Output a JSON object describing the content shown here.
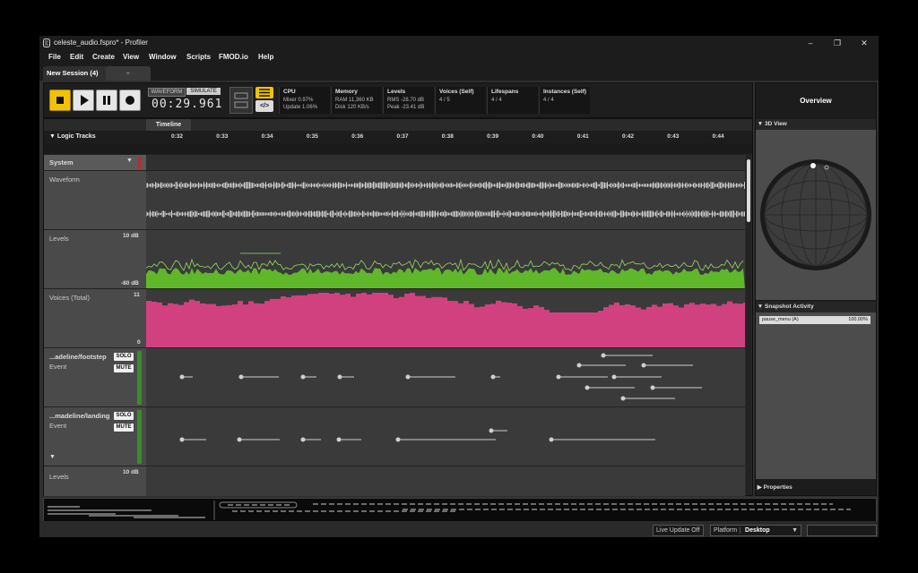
{
  "window": {
    "title": "celeste_audio.fspro* - Profiler"
  },
  "menu": [
    "File",
    "Edit",
    "Create",
    "View",
    "Window",
    "Scripts",
    "FMOD.io",
    "Help"
  ],
  "tabs": {
    "active": "New Session (4)",
    "add": "+"
  },
  "transport": {
    "mode_waveform": "WAVEFORM",
    "mode_simulate": "SIMULATE",
    "time": "00:29.961",
    "code_label": "</>"
  },
  "meters": [
    {
      "title": "CPU",
      "line1": "Mixer 0.97%",
      "line2": "Update 1.06%"
    },
    {
      "title": "Memory",
      "line1": "RAM 11,360 KB",
      "line2": "Disk 120 KB/s"
    },
    {
      "title": "Levels",
      "line1": "RMS -28.70 dB",
      "line2": "Peak -23.41 dB"
    },
    {
      "title": "Voices (Self)",
      "line1": "4 / 5",
      "line2": ""
    },
    {
      "title": "Lifespans",
      "line1": "4 / 4",
      "line2": ""
    },
    {
      "title": "Instances (Self)",
      "line1": "4 / 4",
      "line2": ""
    }
  ],
  "timeline": {
    "header": "Timeline",
    "logic_tracks": "Logic Tracks",
    "ticks": [
      "0:32",
      "0:33",
      "0:34",
      "0:35",
      "0:36",
      "0:37",
      "0:38",
      "0:39",
      "0:40",
      "0:41",
      "0:42",
      "0:43",
      "0:44"
    ]
  },
  "tracks": {
    "system": "System",
    "waveform": "Waveform",
    "levels": {
      "label": "Levels",
      "top": "10 dB",
      "bottom": "-80 dB"
    },
    "voices": {
      "label": "Voices (Total)",
      "top": "11",
      "bottom": "0"
    },
    "footstep": {
      "name": "...adeline/footstep",
      "type": "Event",
      "solo": "SOLO",
      "mute": "MUTE"
    },
    "landing": {
      "name": "...madeline/landing",
      "type": "Event",
      "solo": "SOLO",
      "mute": "MUTE"
    },
    "levels2": {
      "label": "Levels",
      "top": "10 dB"
    }
  },
  "overview": {
    "title": "Overview",
    "view3d": "3D View",
    "snapshot_activity": "Snapshot Activity",
    "snapshot": {
      "name": "pause_menu (A)",
      "value": "100.00%"
    },
    "properties": "Properties"
  },
  "status": {
    "live_update": "Live Update Off",
    "platform_label": "Platform",
    "platform_value": "Desktop"
  },
  "colors": {
    "levels": "#5fb82a",
    "voices": "#d2417f",
    "accent_yellow": "#f2c200"
  }
}
